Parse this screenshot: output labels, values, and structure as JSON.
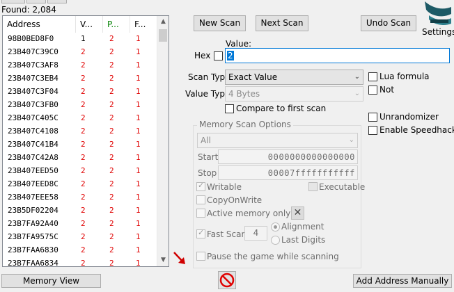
{
  "status": {
    "found": "Found: 2,084"
  },
  "results": {
    "columns": [
      "Address",
      "V...",
      "P...",
      "F..."
    ],
    "rows": [
      {
        "address": "98B0BED8F0",
        "value": "1",
        "previous": "2",
        "first": "1"
      },
      {
        "address": "23B407C39C0",
        "value": "2",
        "previous": "2",
        "first": "1"
      },
      {
        "address": "23B407C3AF8",
        "value": "2",
        "previous": "2",
        "first": "1"
      },
      {
        "address": "23B407C3EB4",
        "value": "2",
        "previous": "2",
        "first": "1"
      },
      {
        "address": "23B407C3F04",
        "value": "2",
        "previous": "2",
        "first": "1"
      },
      {
        "address": "23B407C3FB0",
        "value": "2",
        "previous": "2",
        "first": "1"
      },
      {
        "address": "23B407C405C",
        "value": "2",
        "previous": "2",
        "first": "1"
      },
      {
        "address": "23B407C4108",
        "value": "2",
        "previous": "2",
        "first": "1"
      },
      {
        "address": "23B407C41B4",
        "value": "2",
        "previous": "2",
        "first": "1"
      },
      {
        "address": "23B407C42A8",
        "value": "2",
        "previous": "2",
        "first": "1"
      },
      {
        "address": "23B407EED50",
        "value": "2",
        "previous": "2",
        "first": "1"
      },
      {
        "address": "23B407EED8C",
        "value": "2",
        "previous": "2",
        "first": "1"
      },
      {
        "address": "23B407EEE58",
        "value": "2",
        "previous": "2",
        "first": "1"
      },
      {
        "address": "23B5DF02204",
        "value": "2",
        "previous": "2",
        "first": "1"
      },
      {
        "address": "23B7FA92A40",
        "value": "2",
        "previous": "2",
        "first": "1"
      },
      {
        "address": "23B7FA9575C",
        "value": "2",
        "previous": "2",
        "first": "1"
      },
      {
        "address": "23B7FAA6830",
        "value": "2",
        "previous": "2",
        "first": "1"
      },
      {
        "address": "23B7FAA6834",
        "value": "2",
        "previous": "2",
        "first": "1"
      }
    ]
  },
  "buttons": {
    "new_scan": "New Scan",
    "next_scan": "Next Scan",
    "undo_scan": "Undo Scan",
    "settings": "Settings",
    "memory_view": "Memory View",
    "add_address": "Add Address Manually"
  },
  "value": {
    "label": "Value:",
    "hex_label": "Hex",
    "input_value": "2"
  },
  "scan_type": {
    "label": "Scan Type",
    "selected": "Exact Value"
  },
  "value_type": {
    "label": "Value Type",
    "selected": "4 Bytes"
  },
  "compare_first": "Compare to first scan",
  "right_options": {
    "lua_formula": "Lua formula",
    "not": "Not",
    "unrandomizer": "Unrandomizer",
    "enable_speedhack": "Enable Speedhack"
  },
  "memory_options": {
    "title": "Memory Scan Options",
    "region": "All",
    "start_label": "Start",
    "start_value": "0000000000000000",
    "stop_label": "Stop",
    "stop_value": "00007fffffffffff",
    "writable": "Writable",
    "executable": "Executable",
    "copy_on_write": "CopyOnWrite",
    "active_memory_only": "Active memory only",
    "fast_scan": "Fast Scan",
    "fast_scan_value": "4",
    "alignment": "Alignment",
    "last_digits": "Last Digits",
    "pause_game": "Pause the game while scanning"
  },
  "colors": {
    "changed_value": "#e00000",
    "previous_header": "#008000",
    "focus_border": "#0078d7",
    "arrow_red": "#d00000"
  }
}
